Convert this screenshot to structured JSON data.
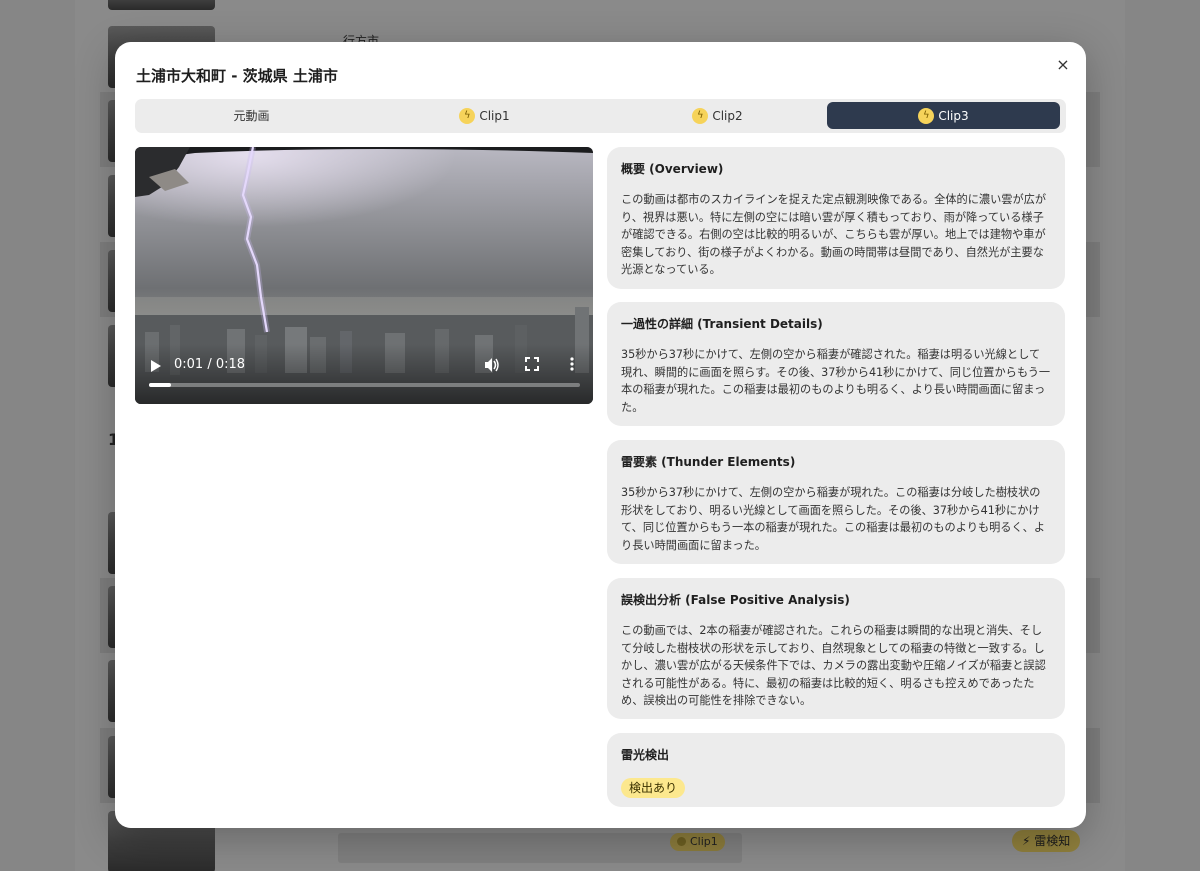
{
  "modal": {
    "title": "土浦市大和町 - 茨城県 土浦市",
    "close_label": "×"
  },
  "tabs": [
    {
      "label": "元動画",
      "icon": "",
      "active": false
    },
    {
      "label": "Clip1",
      "icon": "bolt-icon",
      "active": false
    },
    {
      "label": "Clip2",
      "icon": "bolt-icon",
      "active": false
    },
    {
      "label": "Clip3",
      "icon": "bolt-icon",
      "active": true
    }
  ],
  "video": {
    "time": "0:01 / 0:18",
    "progress": 0.05
  },
  "cards": {
    "overview": {
      "title": "概要 (Overview)",
      "body": "この動画は都市のスカイラインを捉えた定点観測映像である。全体的に濃い雲が広がり、視界は悪い。特に左側の空には暗い雲が厚く積もっており、雨が降っている様子が確認できる。右側の空は比較的明るいが、こちらも雲が厚い。地上では建物や車が密集しており、街の様子がよくわかる。動画の時間帯は昼間であり、自然光が主要な光源となっている。"
    },
    "transient": {
      "title": "一過性の詳細 (Transient Details)",
      "body": "35秒から37秒にかけて、左側の空から稲妻が確認された。稲妻は明るい光線として現れ、瞬間的に画面を照らす。その後、37秒から41秒にかけて、同じ位置からもう一本の稲妻が現れた。この稲妻は最初のものよりも明るく、より長い時間画面に留まった。"
    },
    "thunder": {
      "title": "雷要素 (Thunder Elements)",
      "body": "35秒から37秒にかけて、左側の空から稲妻が現れた。この稲妻は分岐した樹枝状の形状をしており、明るい光線として画面を照らした。その後、37秒から41秒にかけて、同じ位置からもう一本の稲妻が現れた。この稲妻は最初のものよりも明るく、より長い時間画面に留まった。"
    },
    "false_positive": {
      "title": "誤検出分析 (False Positive Analysis)",
      "body": "この動画では、2本の稲妻が確認された。これらの稲妻は瞬間的な出現と消失、そして分岐した樹枝状の形状を示しており、自然現象としての稲妻の特徴と一致する。しかし、濃い雲が広がる天候条件下では、カメラの露出変動や圧縮ノイズが稲妻と誤認される可能性がある。特に、最初の稲妻は比較的短く、明るさも控えめであったため、誤検出の可能性を排除できない。"
    },
    "detection": {
      "title": "雷光検出",
      "badge": "検出あり"
    }
  },
  "background": {
    "city_label": "行方市",
    "clip_badge": "Clip1",
    "detect_pill": "雷検知",
    "count_fragment": "1"
  },
  "colors": {
    "active_tab": "#2e3a4e",
    "badge_yellow": "#fce88e",
    "icon_yellow": "#f6d35a",
    "card_bg": "#ececec"
  }
}
